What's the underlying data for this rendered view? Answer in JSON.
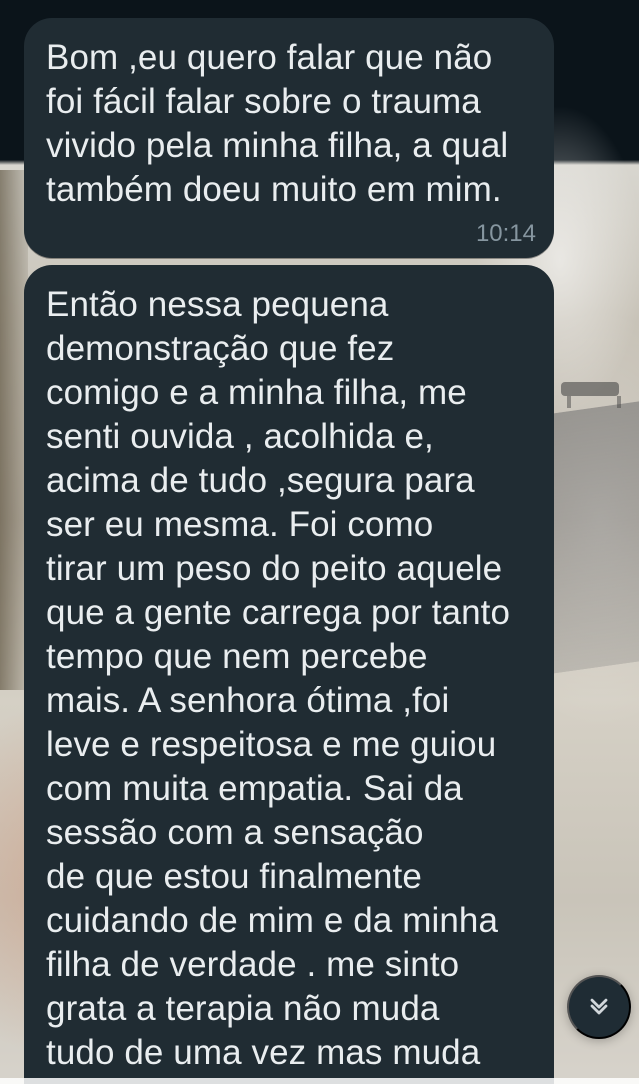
{
  "messages": [
    {
      "text": "Bom ,eu quero falar que não\nfoi fácil falar sobre o trauma\nvivido pela minha filha, a qual\ntambém doeu muito em mim.",
      "time": "10:14"
    },
    {
      "text": "Então nessa pequena\ndemonstração que fez\ncomigo e a minha filha, me\nsenti ouvida , acolhida e,\nacima de tudo ,segura para\nser eu  mesma. Foi como\ntirar um peso do peito aquele\nque a gente carrega por tanto\ntempo que nem percebe\nmais. A senhora ótima ,foi\nleve e  respeitosa e me guiou\ncom muita empatia. Sai da\nsessão com a sensação\nde que estou finalmente\ncuidando de mim e da minha\nfilha de verdade .  me sinto\ngrata a terapia não muda\ntudo de uma vez mas muda"
    }
  ],
  "ui": {
    "scroll_down_icon": "double-chevron-down-icon"
  },
  "colors": {
    "bubble_bg": "#202c33",
    "text_primary": "#e9edef",
    "text_meta": "#8696a0",
    "fab_bg": "#1f2c34",
    "fab_icon": "#d1d7db"
  }
}
